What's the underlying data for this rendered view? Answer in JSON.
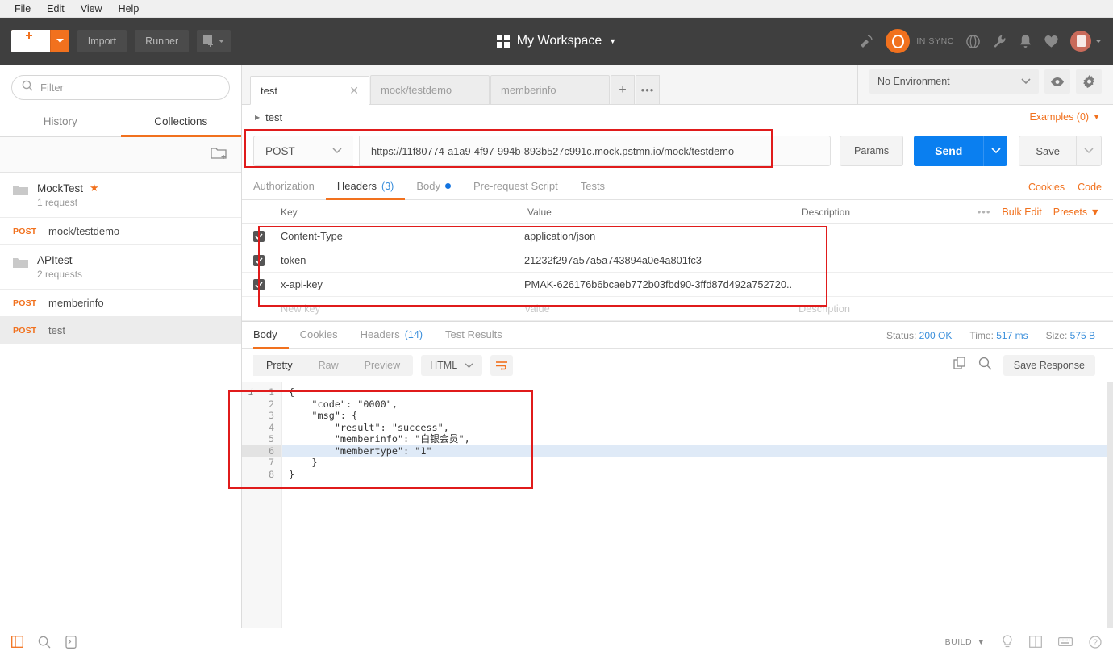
{
  "menubar": {
    "items": [
      "File",
      "Edit",
      "View",
      "Help"
    ]
  },
  "toolbar": {
    "new_label": "New",
    "import_label": "Import",
    "runner_label": "Runner",
    "workspace_title": "My Workspace",
    "sync_status": "IN SYNC"
  },
  "sidebar": {
    "filter_placeholder": "Filter",
    "tabs": [
      {
        "label": "History",
        "active": false
      },
      {
        "label": "Collections",
        "active": true
      }
    ],
    "items": [
      {
        "type": "collection",
        "name": "MockTest",
        "sub": "1 request",
        "starred": true
      },
      {
        "type": "request",
        "method": "POST",
        "name": "mock/testdemo",
        "selected": false
      },
      {
        "type": "collection",
        "name": "APItest",
        "sub": "2 requests",
        "starred": false
      },
      {
        "type": "request",
        "method": "POST",
        "name": "memberinfo",
        "selected": false
      },
      {
        "type": "request",
        "method": "POST",
        "name": "test",
        "selected": true
      }
    ]
  },
  "tabstrip": {
    "tabs": [
      {
        "label": "test",
        "active": true
      },
      {
        "label": "mock/testdemo",
        "active": false
      },
      {
        "label": "memberinfo",
        "active": false
      }
    ],
    "environment": "No Environment"
  },
  "request": {
    "breadcrumb": "test",
    "examples_label": "Examples (0)",
    "method": "POST",
    "url": "https://11f80774-a1a9-4f97-994b-893b527c991c.mock.pstmn.io/mock/testdemo",
    "params_label": "Params",
    "send_label": "Send",
    "save_label": "Save",
    "cookies_label": "Cookies",
    "code_label": "Code",
    "tabs": [
      {
        "label": "Authorization",
        "active": false,
        "count": "",
        "dot": false
      },
      {
        "label": "Headers",
        "active": true,
        "count": "(3)",
        "dot": false
      },
      {
        "label": "Body",
        "active": false,
        "count": "",
        "dot": true
      },
      {
        "label": "Pre-request Script",
        "active": false,
        "count": "",
        "dot": false
      },
      {
        "label": "Tests",
        "active": false,
        "count": "",
        "dot": false
      }
    ],
    "headers_table": {
      "columns": [
        "Key",
        "Value",
        "Description"
      ],
      "bulk_edit_label": "Bulk Edit",
      "presets_label": "Presets",
      "rows": [
        {
          "checked": true,
          "key": "Content-Type",
          "value": "application/json",
          "description": ""
        },
        {
          "checked": true,
          "key": "token",
          "value": "21232f297a57a5a743894a0e4a801fc3",
          "description": ""
        },
        {
          "checked": true,
          "key": "x-api-key",
          "value": "PMAK-626176b6bcaeb772b03fbd90-3ffd87d492a752720..",
          "description": ""
        }
      ],
      "new_row": {
        "key": "New key",
        "value": "Value",
        "description": "Description"
      }
    }
  },
  "response": {
    "tabs": [
      {
        "label": "Body",
        "active": true,
        "count": ""
      },
      {
        "label": "Cookies",
        "active": false,
        "count": ""
      },
      {
        "label": "Headers",
        "active": false,
        "count": "(14)"
      },
      {
        "label": "Test Results",
        "active": false,
        "count": ""
      }
    ],
    "status_label": "Status:",
    "status_value": "200 OK",
    "time_label": "Time:",
    "time_value": "517 ms",
    "size_label": "Size:",
    "size_value": "575 B",
    "view_modes": [
      {
        "label": "Pretty",
        "active": true
      },
      {
        "label": "Raw",
        "active": false
      },
      {
        "label": "Preview",
        "active": false
      }
    ],
    "format": "HTML",
    "save_response_label": "Save Response",
    "body_lines": [
      {
        "n": "1",
        "text": "{",
        "highlight": false
      },
      {
        "n": "2",
        "text": "    \"code\": \"0000\",",
        "highlight": false
      },
      {
        "n": "3",
        "text": "    \"msg\": {",
        "highlight": false
      },
      {
        "n": "4",
        "text": "        \"result\": \"success\",",
        "highlight": false
      },
      {
        "n": "5",
        "text": "        \"memberinfo\": \"白银会员\",",
        "highlight": false
      },
      {
        "n": "6",
        "text": "        \"membertype\": \"1\"",
        "highlight": true
      },
      {
        "n": "7",
        "text": "    }",
        "highlight": false
      },
      {
        "n": "8",
        "text": "}",
        "highlight": false
      }
    ]
  },
  "statusbar": {
    "build_label": "BUILD"
  }
}
